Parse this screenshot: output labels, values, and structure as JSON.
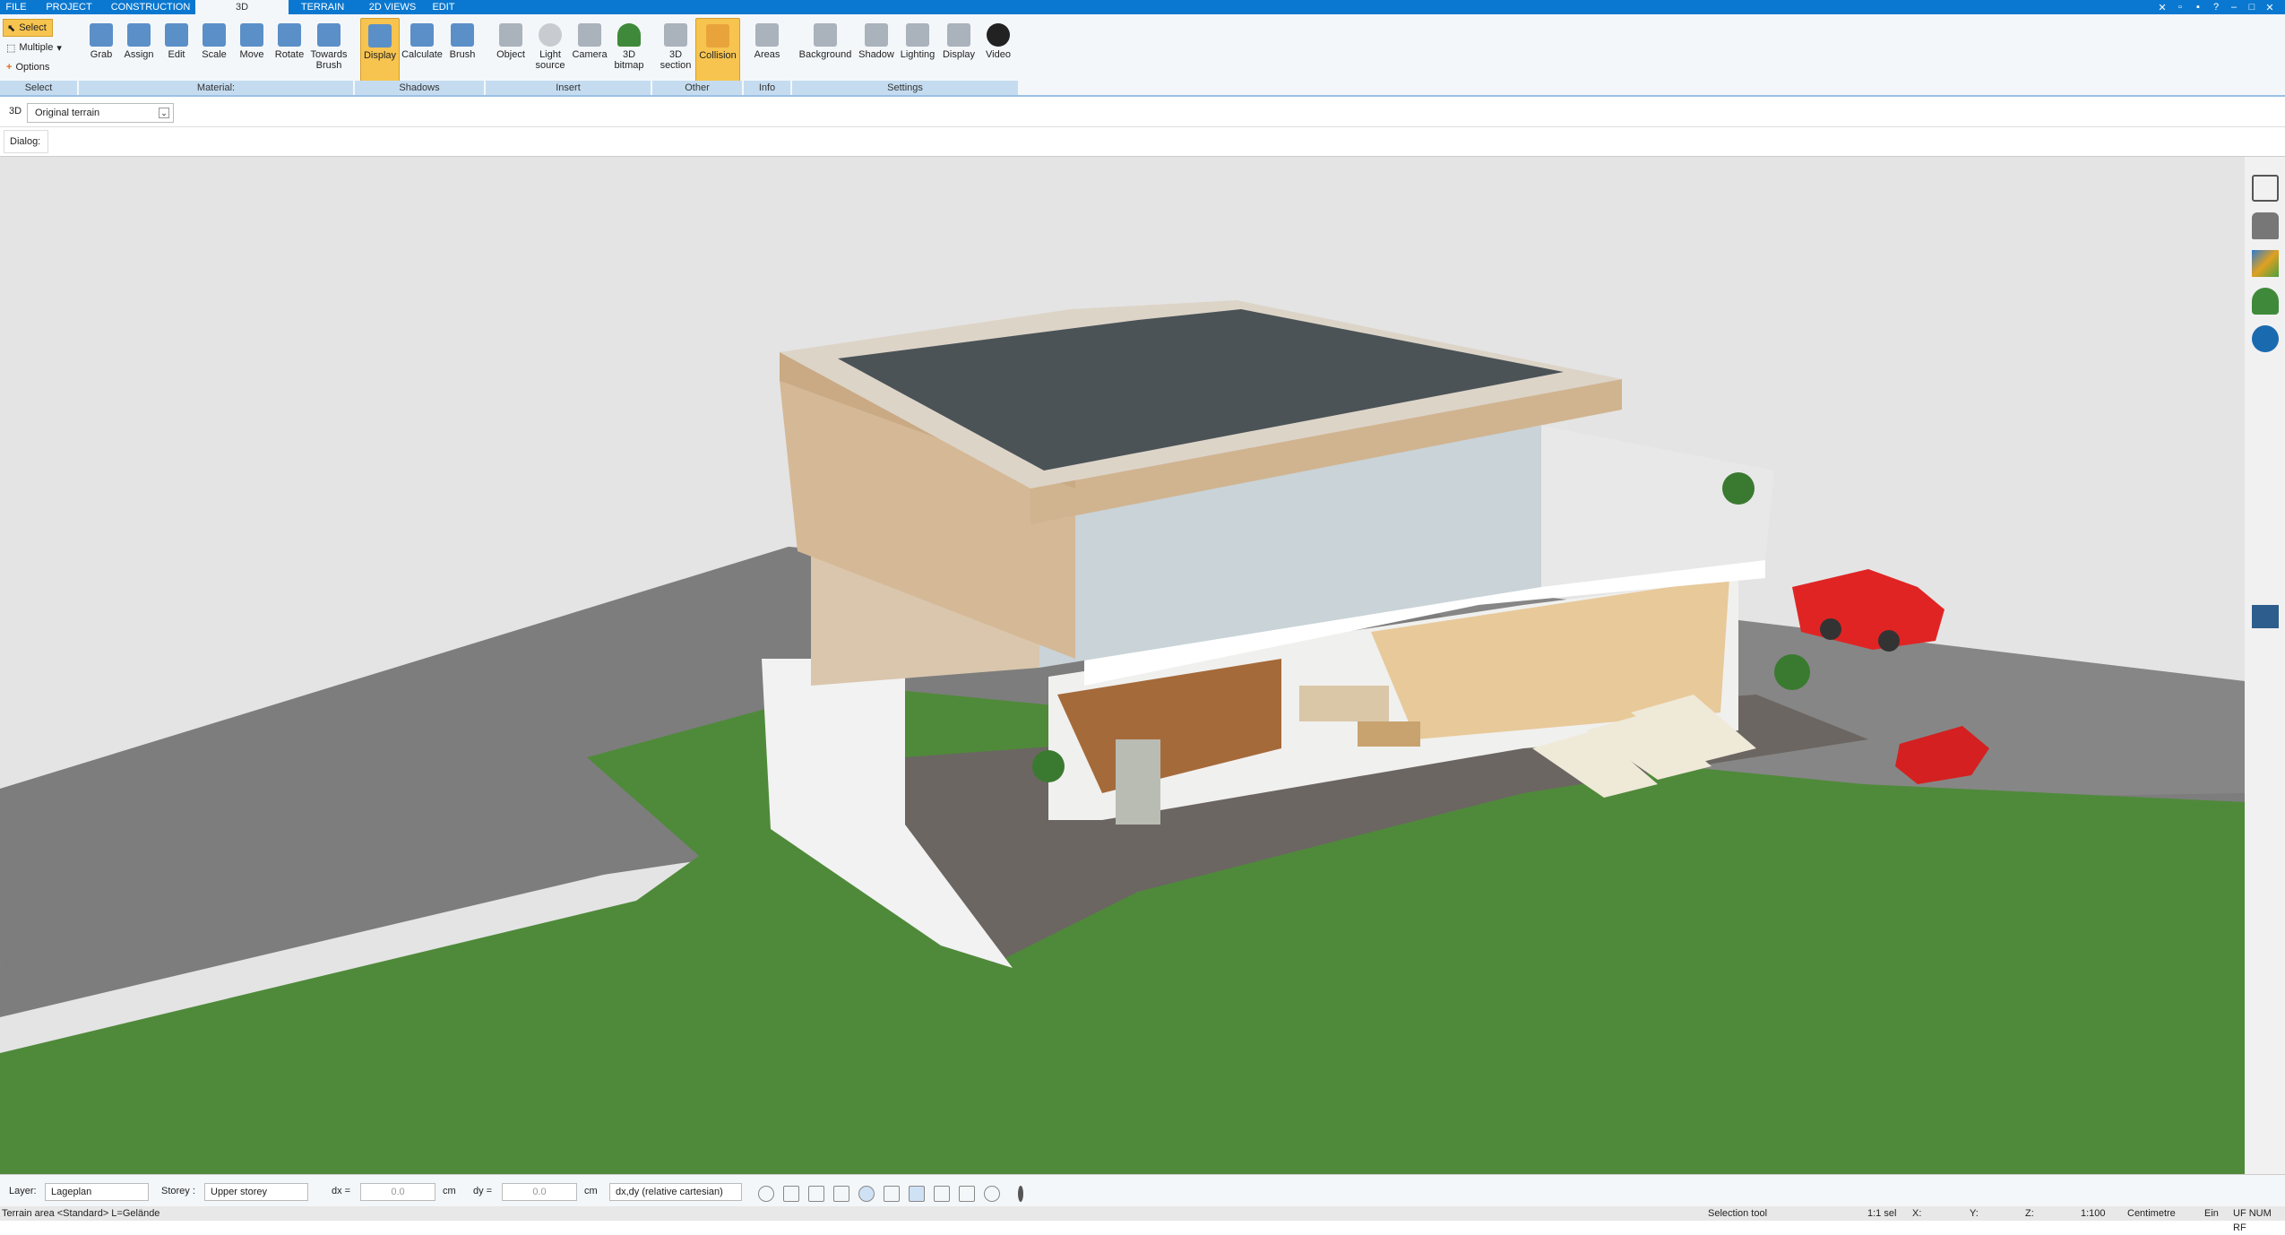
{
  "tabs": [
    "FILE",
    "PROJECT",
    "CONSTRUCTION",
    "3D",
    "TERRAIN",
    "2D VIEWS",
    "EDIT"
  ],
  "active_tab": "3D",
  "select_group": {
    "select": "Select",
    "multiple": "Multiple",
    "options": "Options",
    "label": "Select"
  },
  "material_group": {
    "label": "Material:",
    "buttons": [
      "Grab",
      "Assign",
      "Edit",
      "Scale",
      "Move",
      "Rotate",
      "Towards Brush"
    ]
  },
  "shadows_group": {
    "label": "Shadows",
    "buttons": [
      "Display",
      "Calculate",
      "Brush"
    ]
  },
  "insert_group": {
    "label": "Insert",
    "buttons": [
      "Object",
      "Light source",
      "Camera",
      "3D bitmap"
    ]
  },
  "other_group": {
    "label": "Other",
    "buttons": [
      "3D section",
      "Collision"
    ]
  },
  "info_group": {
    "label": "Info",
    "buttons": [
      "Areas"
    ]
  },
  "settings_group": {
    "label": "Settings",
    "buttons": [
      "Background",
      "Shadow",
      "Lighting",
      "Display",
      "Video"
    ]
  },
  "view": {
    "mode": "3D",
    "terrain": "Original terrain",
    "dialog_label": "Dialog:"
  },
  "statusbar": {
    "layer_label": "Layer:",
    "layer_value": "Lageplan",
    "storey_label": "Storey :",
    "storey_value": "Upper storey",
    "dx_label": "dx =",
    "dx_value": "0.0",
    "dx_unit": "cm",
    "dy_label": "dy =",
    "dy_value": "0.0",
    "dy_unit": "cm",
    "coord_mode": "dx,dy (relative cartesian)"
  },
  "infobar": {
    "left": "Terrain area <Standard> L=Gelände",
    "tool": "Selection tool",
    "sel": "1:1 sel",
    "x": "X:",
    "y": "Y:",
    "z": "Z:",
    "scale": "1:100",
    "unit": "Centimetre",
    "ein": "Ein",
    "flags": "UF NUM RF"
  },
  "colors": {
    "ribbon_tab": "#0a78d0",
    "active_btn": "#f7c44f",
    "grass": "#4f8a3a",
    "road": "#7d7d7d"
  }
}
